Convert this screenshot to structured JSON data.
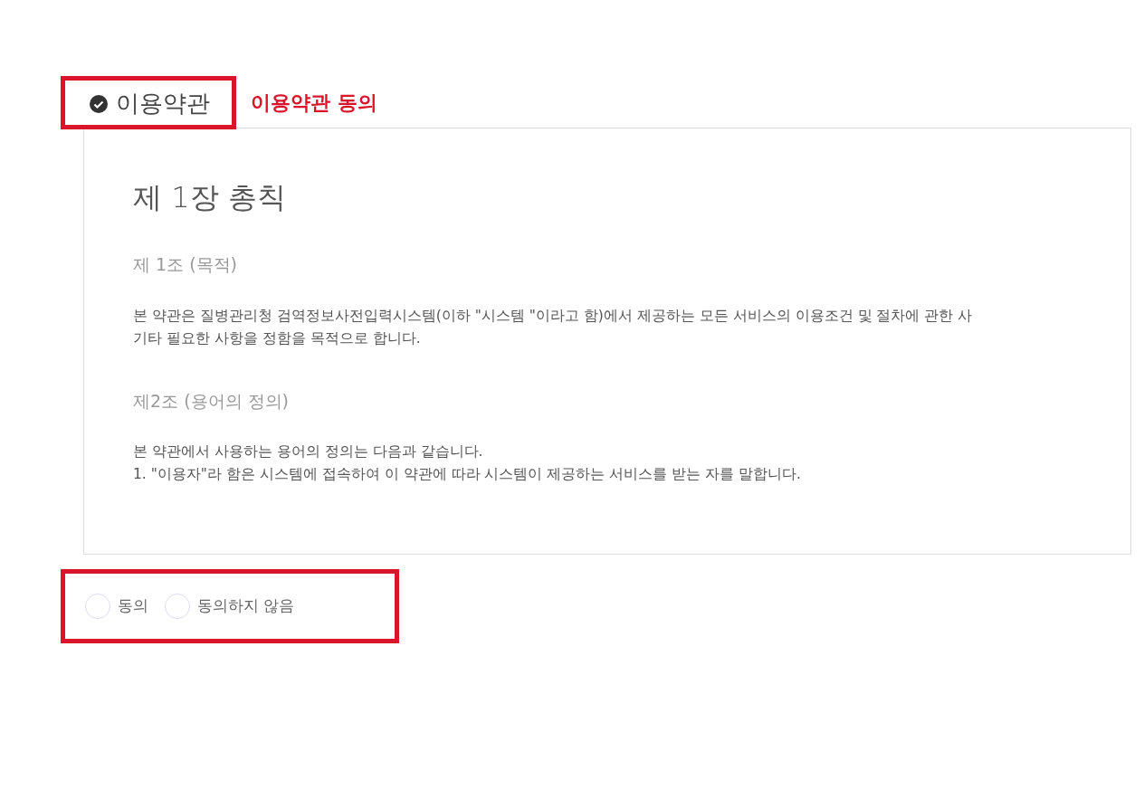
{
  "section": {
    "title": "이용약관",
    "checked": true,
    "annotation": "이용약관 동의"
  },
  "terms": {
    "chapter": "제 1장 총칙",
    "articles": [
      {
        "heading": "제 1조 (목적)",
        "lines": [
          "본 약관은 질병관리청 검역정보사전입력시스템(이하 \"시스템 \"이라고 함)에서 제공하는 모든 서비스의 이용조건 및 절차에 관한 사",
          "기타 필요한 사항을 정함을 목적으로 합니다."
        ]
      },
      {
        "heading": "제2조 (용어의 정의)",
        "lines": [
          "본 약관에서 사용하는 용어의 정의는 다음과 같습니다.",
          "1. \"이용자\"라 함은 시스템에 접속하여 이 약관에 따라 시스템이 제공하는 서비스를 받는 자를 말합니다."
        ]
      }
    ]
  },
  "consent": [
    {
      "label": "동의",
      "selected": false
    },
    {
      "label": "동의하지 않음",
      "selected": false
    }
  ]
}
